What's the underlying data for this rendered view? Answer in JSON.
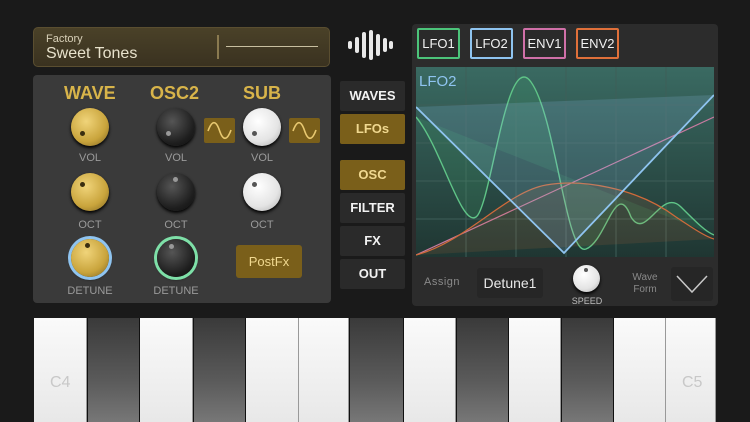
{
  "preset": {
    "category": "Factory",
    "name": "Sweet Tones"
  },
  "logo": {
    "icon": "waveform-logo-icon"
  },
  "osc": {
    "headers": [
      "WAVE",
      "OSC2",
      "SUB"
    ],
    "labels": {
      "vol": "VOL",
      "oct": "OCT",
      "detune": "DETUNE"
    },
    "postfx": "PostFx"
  },
  "menu": {
    "waves": "WAVES",
    "lfos": "LFOs",
    "osc": "OSC",
    "filter": "FILTER",
    "fx": "FX",
    "out": "OUT"
  },
  "lfo": {
    "tabs": [
      {
        "label": "LFO1",
        "color": "#4cc47a"
      },
      {
        "label": "LFO2",
        "color": "#8fc4f0"
      },
      {
        "label": "ENV1",
        "color": "#d070a8"
      },
      {
        "label": "ENV2",
        "color": "#e0703a"
      }
    ],
    "plot_title": "LFO2",
    "assign_label": "Assign",
    "assign_value": "Detune1",
    "speed_label": "SPEED",
    "wave_form_label_1": "Wave",
    "wave_form_label_2": "Form"
  },
  "keyboard": {
    "note_start": "C4",
    "note_end": "C5"
  },
  "colors": {
    "accent": "#d8b44a",
    "panel": "#3a3a3a",
    "plot_bg": "#26403c"
  }
}
